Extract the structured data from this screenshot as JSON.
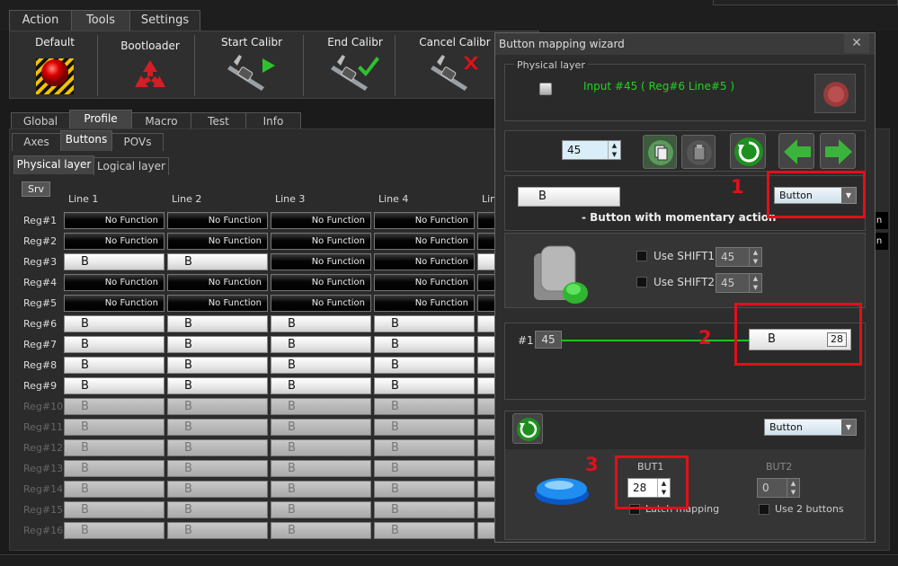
{
  "menu": {
    "tabs": [
      "Action",
      "Tools",
      "Settings"
    ],
    "active": "Tools"
  },
  "toolbar": {
    "default_label": "Default",
    "bootloader_label": "Bootloader",
    "start_calibr_label": "Start Calibr",
    "end_calibr_label": "End Calibr",
    "cancel_calibr_label": "Cancel Calibr"
  },
  "main_tabs": [
    "Global",
    "Profile",
    "Macro",
    "Test",
    "Info"
  ],
  "sub_tabs": [
    "Axes",
    "Buttons",
    "POVs"
  ],
  "layer_tabs": [
    "Physical layer",
    "Logical layer"
  ],
  "srv_label": "Srv",
  "grid": {
    "columns": [
      "Line 1",
      "Line 2",
      "Line 3",
      "Line 4",
      "Lin"
    ],
    "rows": [
      {
        "label": "Reg#1",
        "cells": [
          "No Function",
          "No Function",
          "No Function",
          "No Function"
        ]
      },
      {
        "label": "Reg#2",
        "cells": [
          "No Function",
          "No Function",
          "No Function",
          "No Function"
        ]
      },
      {
        "label": "Reg#3",
        "cells": [
          "B",
          "B",
          "No Function",
          "No Function"
        ]
      },
      {
        "label": "Reg#4",
        "cells": [
          "No Function",
          "No Function",
          "No Function",
          "No Function"
        ]
      },
      {
        "label": "Reg#5",
        "cells": [
          "No Function",
          "No Function",
          "No Function",
          "No Function"
        ]
      },
      {
        "label": "Reg#6",
        "cells": [
          "B",
          "B",
          "B",
          "B"
        ]
      },
      {
        "label": "Reg#7",
        "cells": [
          "B",
          "B",
          "B",
          "B"
        ]
      },
      {
        "label": "Reg#8",
        "cells": [
          "B",
          "B",
          "B",
          "B"
        ]
      },
      {
        "label": "Reg#9",
        "cells": [
          "B",
          "B",
          "B",
          "B"
        ]
      },
      {
        "label": "Reg#10",
        "cells": [
          "B",
          "B",
          "B",
          "B"
        ],
        "disabled": true
      },
      {
        "label": "Reg#11",
        "cells": [
          "B",
          "B",
          "B",
          "B"
        ],
        "disabled": true
      },
      {
        "label": "Reg#12",
        "cells": [
          "B",
          "B",
          "B",
          "B"
        ],
        "disabled": true
      },
      {
        "label": "Reg#13",
        "cells": [
          "B",
          "B",
          "B",
          "B"
        ],
        "disabled": true
      },
      {
        "label": "Reg#14",
        "cells": [
          "B",
          "B",
          "B",
          "B"
        ],
        "disabled": true
      },
      {
        "label": "Reg#15",
        "cells": [
          "B",
          "B",
          "B",
          "B"
        ],
        "disabled": true
      },
      {
        "label": "Reg#16",
        "cells": [
          "B",
          "B",
          "B",
          "B"
        ],
        "disabled": true
      }
    ],
    "right_edge_text": "n"
  },
  "wizard": {
    "title": "Button mapping wizard",
    "close_glyph": "✕",
    "physical_layer_label": "Physical layer",
    "input_info": "Input #45  ( Reg#6   Line#5 )",
    "input_number": "45",
    "button_field": "B",
    "type_dropdown": "Button",
    "description": "- Button with momentary action",
    "shift1_label": "Use SHIFT1",
    "shift1_value": "45",
    "shift2_label": "Use SHIFT2",
    "shift2_value": "45",
    "map_prefix": "#1",
    "map_input": "45",
    "map_target": "B",
    "map_target_value": "28",
    "second_dropdown": "Button",
    "but1_label": "BUT1",
    "but1_value": "28",
    "but2_label": "BUT2",
    "but2_value": "0",
    "latch_label": "Latch mapping",
    "use2_label": "Use 2 buttons"
  },
  "annotations": [
    "1",
    "2",
    "3"
  ],
  "colors": {
    "accent_red": "#e0101a",
    "green_text": "#21d321",
    "panel_bg": "#2b2b2b"
  }
}
